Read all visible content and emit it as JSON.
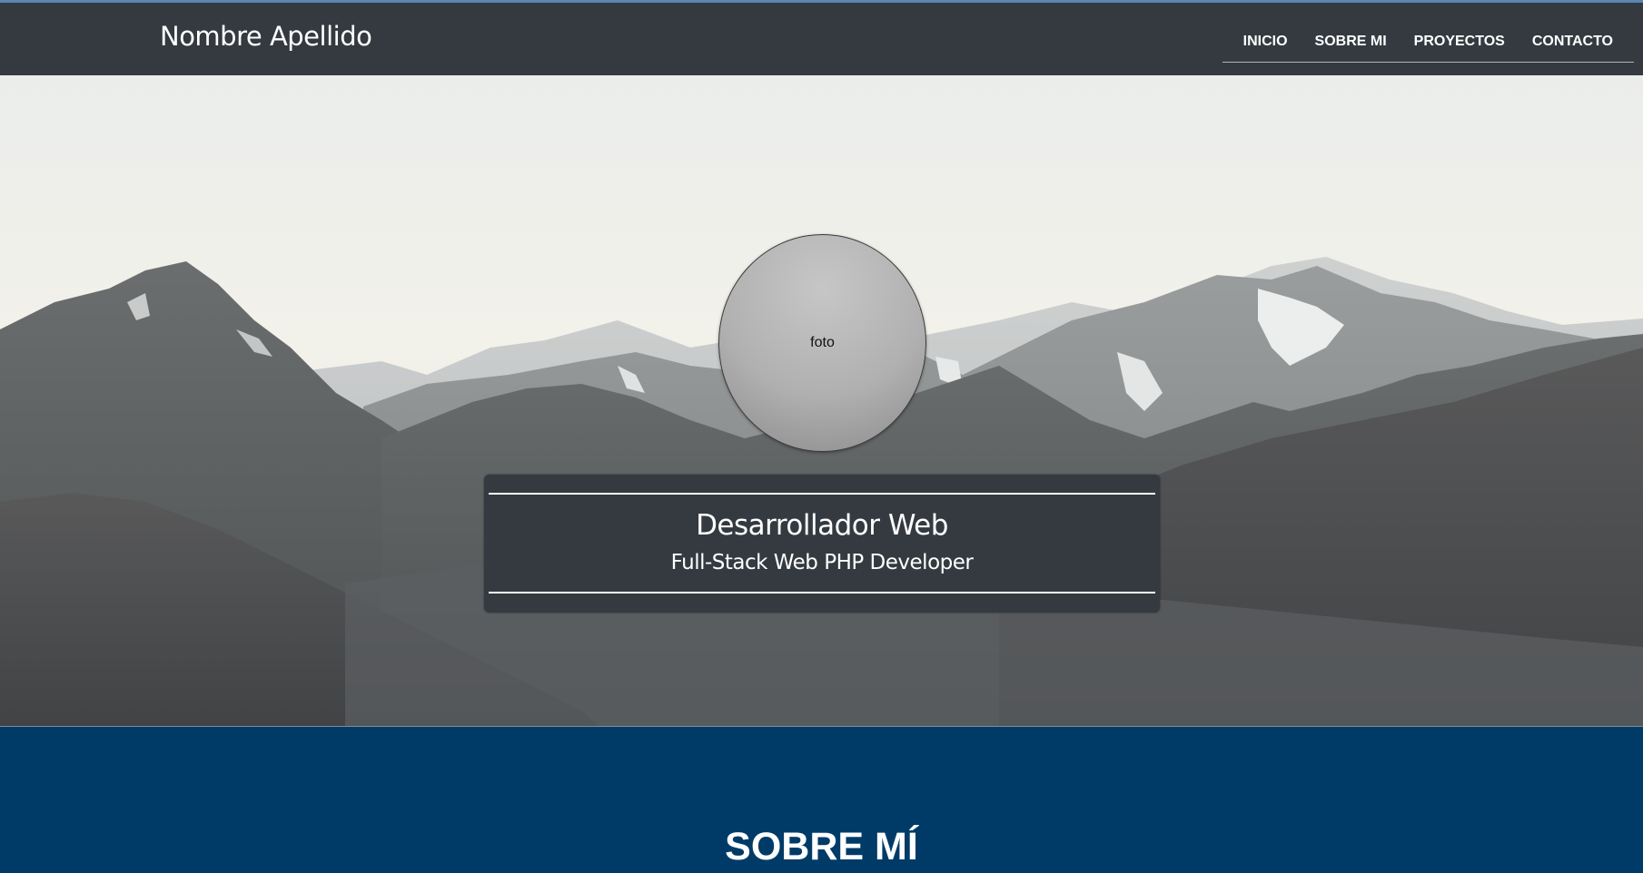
{
  "header": {
    "brand": "Nombre Apellido",
    "nav": [
      {
        "label": "INICIO"
      },
      {
        "label": "SOBRE MI"
      },
      {
        "label": "PROYECTOS"
      },
      {
        "label": "CONTACTO"
      }
    ]
  },
  "hero": {
    "photo_label": "foto",
    "title": "Desarrollador Web",
    "subtitle": "Full-Stack Web PHP Developer"
  },
  "about": {
    "title": "SOBRE MÍ"
  },
  "colors": {
    "navbar": "#343a40",
    "about_background": "#003b68",
    "text": "#ffffff"
  }
}
